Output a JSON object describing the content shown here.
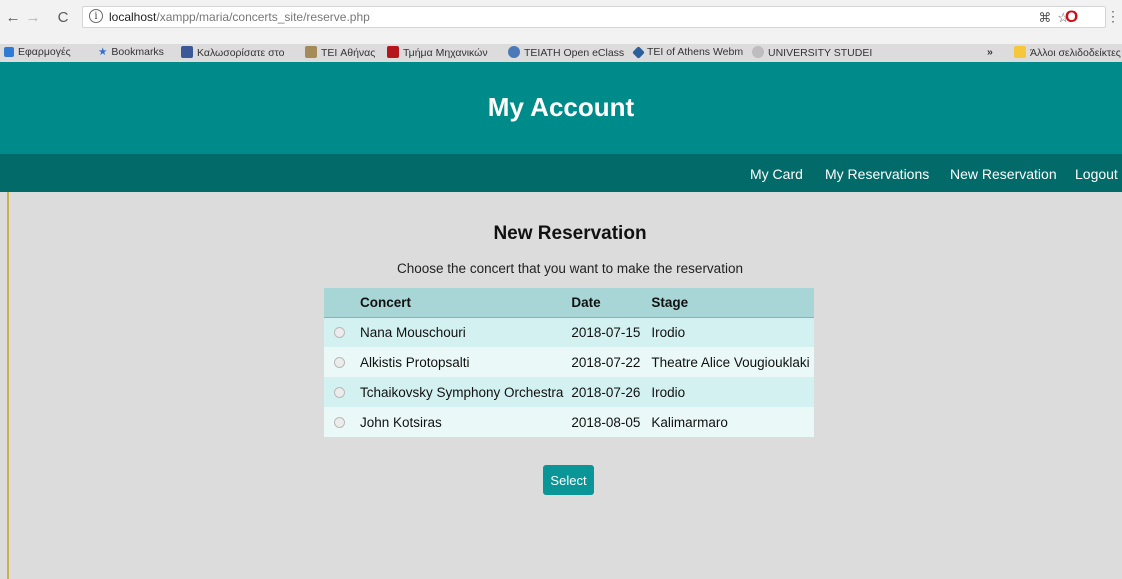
{
  "browser": {
    "url_host": "localhost",
    "url_path": "/xampp/maria/concerts_site/reserve.php",
    "bookmarks": [
      "Εφαρμογές",
      "Bookmarks",
      "Καλωσορίσατε στο",
      "TEI Αθήνας",
      "Τμήμα Μηχανικών",
      "TEIATH Open eClass",
      "TEI of Athens Webm",
      "UNIVERSITY STUDEI",
      "Άλλοι σελιδοδείκτες"
    ],
    "overflow_label": "»"
  },
  "header": {
    "title": "My Account"
  },
  "nav": {
    "items": [
      "My Card",
      "My Reservations",
      "New Reservation",
      "Logout"
    ]
  },
  "main": {
    "title": "New Reservation",
    "subtitle": "Choose the concert that you want to make the reservation",
    "columns": [
      "Concert",
      "Date",
      "Stage"
    ],
    "rows": [
      {
        "concert": "Nana Mouschouri",
        "date": "2018-07-15",
        "stage": "Irodio"
      },
      {
        "concert": "Alkistis Protopsalti",
        "date": "2018-07-22",
        "stage": "Theatre Alice Vougiouklaki"
      },
      {
        "concert": "Tchaikovsky Symphony Orchestra",
        "date": "2018-07-26",
        "stage": "Irodio"
      },
      {
        "concert": "John Kotsiras",
        "date": "2018-08-05",
        "stage": "Kalimarmaro"
      }
    ],
    "select_label": "Select"
  },
  "colors": {
    "header_bg": "#008b8b",
    "nav_bg": "#036a6a",
    "button_bg": "#0a9696",
    "table_header_bg": "#a8d6d6"
  }
}
